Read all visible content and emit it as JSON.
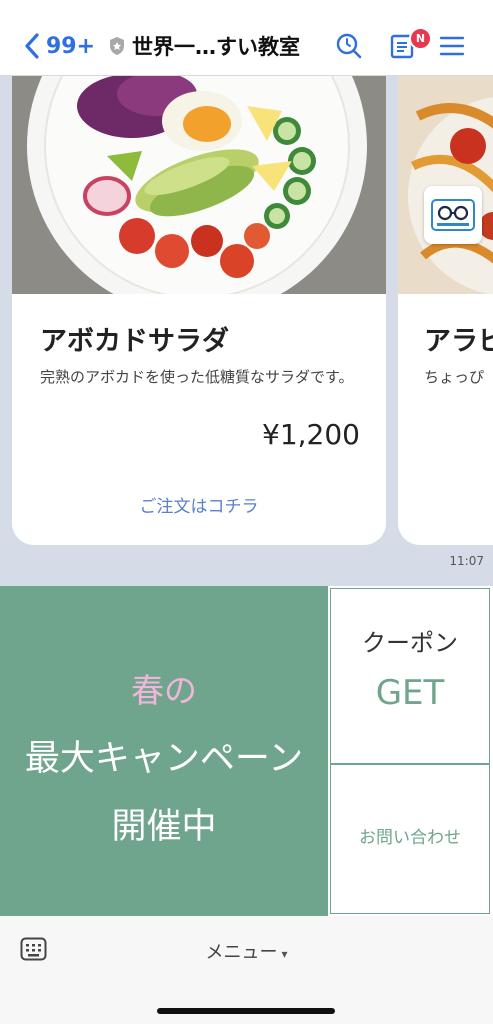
{
  "header": {
    "back_count": "99+",
    "title": "世界一…すい教室",
    "notification_badge": "N",
    "icons": [
      "back-chevron-icon",
      "shield-icon",
      "search-icon",
      "notes-icon",
      "menu-icon"
    ],
    "accent_color": "#2f6fde"
  },
  "cards": [
    {
      "title": "アボカドサラダ",
      "description": "完熟のアボカドを使った低糖質なサラダです。",
      "price": "¥1,200",
      "link": "ご注文はコチラ"
    },
    {
      "title": "アラビ",
      "description": "ちょっぴ"
    }
  ],
  "timestamp": "11:07",
  "rich_menu": {
    "campaign": [
      "春の",
      "最大キャンペーン",
      "開催中"
    ],
    "coupon": [
      "クーポン",
      "GET"
    ],
    "contact": "お問い合わせ",
    "theme_color": "#6fa58c"
  },
  "bottom": {
    "menu_label": "メニュー",
    "caret": "▾"
  }
}
